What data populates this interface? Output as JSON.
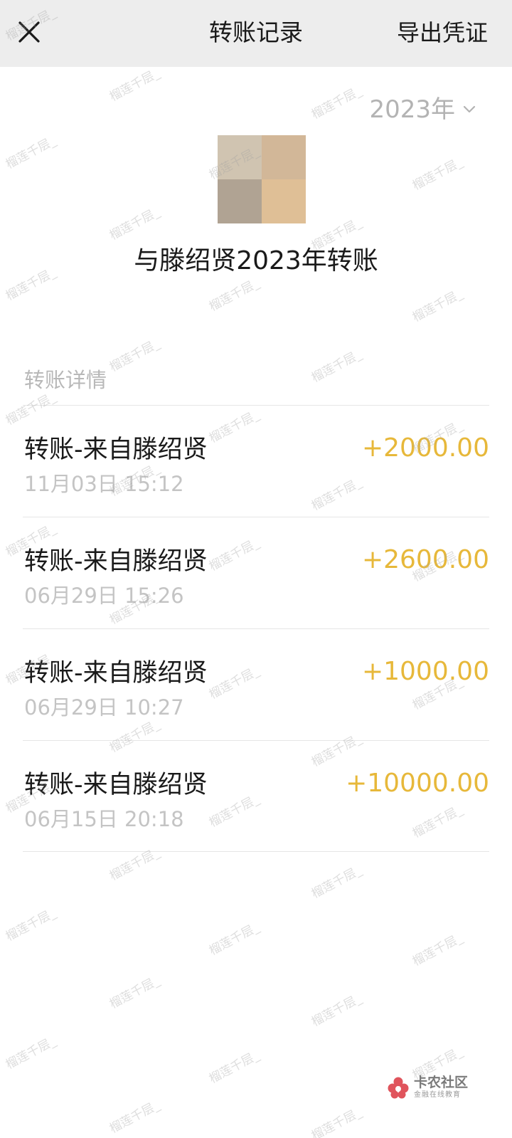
{
  "navbar": {
    "title": "转账记录",
    "action_label": "导出凭证",
    "close_icon": "close-icon"
  },
  "year_selector": {
    "label": "2023年",
    "icon": "chevron-down-icon"
  },
  "avatar": {
    "colors": [
      "#d0c4b1",
      "#d2b798",
      "#b0a393",
      "#dfbf96"
    ]
  },
  "summary_title": "与滕绍贤2023年转账",
  "section_header": "转账详情",
  "records": [
    {
      "title": "转账-来自滕绍贤",
      "time": "11月03日 15:12",
      "amount": "+2000.00"
    },
    {
      "title": "转账-来自滕绍贤",
      "time": "06月29日 15:26",
      "amount": "+2600.00"
    },
    {
      "title": "转账-来自滕绍贤",
      "time": "06月29日 10:27",
      "amount": "+1000.00"
    },
    {
      "title": "转账-来自滕绍贤",
      "time": "06月15日 20:18",
      "amount": "+10000.00"
    }
  ],
  "watermark_text": "榴莲千层_",
  "logo": {
    "main": "卡农社区",
    "sub": "金融在线教育"
  },
  "colors": {
    "amount": "#e7b83a",
    "nav_bg": "#ededed",
    "muted_text": "#b8b8b8"
  }
}
